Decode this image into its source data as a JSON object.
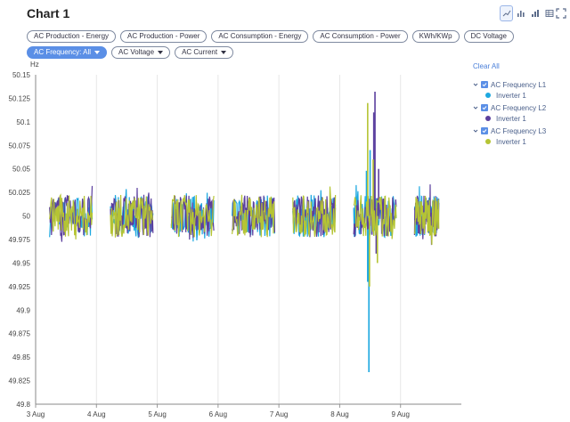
{
  "window": {
    "title": "Chart 1"
  },
  "toolbar": {
    "buttons": [
      {
        "name": "line-chart-icon",
        "active": true
      },
      {
        "name": "bar-chart-icon",
        "active": false
      },
      {
        "name": "stacked-bar-icon",
        "active": false
      },
      {
        "name": "table-view-icon",
        "active": false
      }
    ],
    "expand_icon": "expand-icon"
  },
  "filters": [
    {
      "label": "AC Production - Energy",
      "selected": false,
      "dropdown": false
    },
    {
      "label": "AC Production - Power",
      "selected": false,
      "dropdown": false
    },
    {
      "label": "AC Consumption - Energy",
      "selected": false,
      "dropdown": false
    },
    {
      "label": "AC Consumption - Power",
      "selected": false,
      "dropdown": false
    },
    {
      "label": "KWh/KWp",
      "selected": false,
      "dropdown": false
    },
    {
      "label": "DC Voltage",
      "selected": false,
      "dropdown": false
    },
    {
      "label": "AC Frequency: All",
      "selected": true,
      "dropdown": true
    },
    {
      "label": "AC Voltage",
      "selected": false,
      "dropdown": true
    },
    {
      "label": "AC Current",
      "selected": false,
      "dropdown": true
    }
  ],
  "legend": {
    "clear_label": "Clear All",
    "groups": [
      {
        "label": "AC Frequency L1",
        "item": "Inverter 1",
        "color": "#1da8e0"
      },
      {
        "label": "AC Frequency L2",
        "item": "Inverter 1",
        "color": "#5b3f9e"
      },
      {
        "label": "AC Frequency L3",
        "item": "Inverter 1",
        "color": "#b5c434"
      }
    ]
  },
  "colors": {
    "accent": "#5b8fe6",
    "l1": "#1da8e0",
    "l2": "#5b3f9e",
    "l3": "#b5c434"
  },
  "chart_data": {
    "type": "line",
    "ylabel": "Hz",
    "ylim": [
      49.8,
      50.15
    ],
    "yticks": [
      "50.15",
      "50.125",
      "50.1",
      "50.075",
      "50.05",
      "50.025",
      "50",
      "49.975",
      "49.95",
      "49.925",
      "49.9",
      "49.875",
      "49.85",
      "49.825",
      "49.8"
    ],
    "xlim": [
      3,
      10
    ],
    "xticks": [
      {
        "value": 3,
        "label": "3 Aug"
      },
      {
        "value": 4,
        "label": "4 Aug"
      },
      {
        "value": 5,
        "label": "5 Aug"
      },
      {
        "value": 6,
        "label": "6 Aug"
      },
      {
        "value": 7,
        "label": "7 Aug"
      },
      {
        "value": 8,
        "label": "8 Aug"
      },
      {
        "value": 9,
        "label": "9 Aug"
      }
    ],
    "grid": "vertical",
    "day_segments": [
      [
        3.23,
        3.93
      ],
      [
        4.23,
        4.93
      ],
      [
        5.23,
        5.93
      ],
      [
        6.23,
        6.93
      ],
      [
        7.23,
        7.93
      ],
      [
        8.23,
        8.93
      ],
      [
        9.23,
        9.63
      ]
    ],
    "series": [
      {
        "name": "AC Frequency L1",
        "color": "#1da8e0",
        "spikes": [
          [
            8.48,
            49.834
          ],
          [
            8.44,
            50.048
          ],
          [
            8.46,
            49.93
          ],
          [
            8.5,
            50.07
          ]
        ]
      },
      {
        "name": "AC Frequency L2",
        "color": "#5b3f9e",
        "spikes": [
          [
            8.58,
            50.132
          ],
          [
            8.53,
            49.98
          ],
          [
            8.56,
            50.11
          ],
          [
            8.6,
            49.96
          ],
          [
            8.64,
            50.05
          ]
        ]
      },
      {
        "name": "AC Frequency L3",
        "color": "#b5c434",
        "spikes": [
          [
            8.46,
            50.12
          ],
          [
            8.49,
            49.925
          ],
          [
            8.55,
            50.06
          ],
          [
            8.62,
            49.95
          ]
        ]
      }
    ]
  }
}
